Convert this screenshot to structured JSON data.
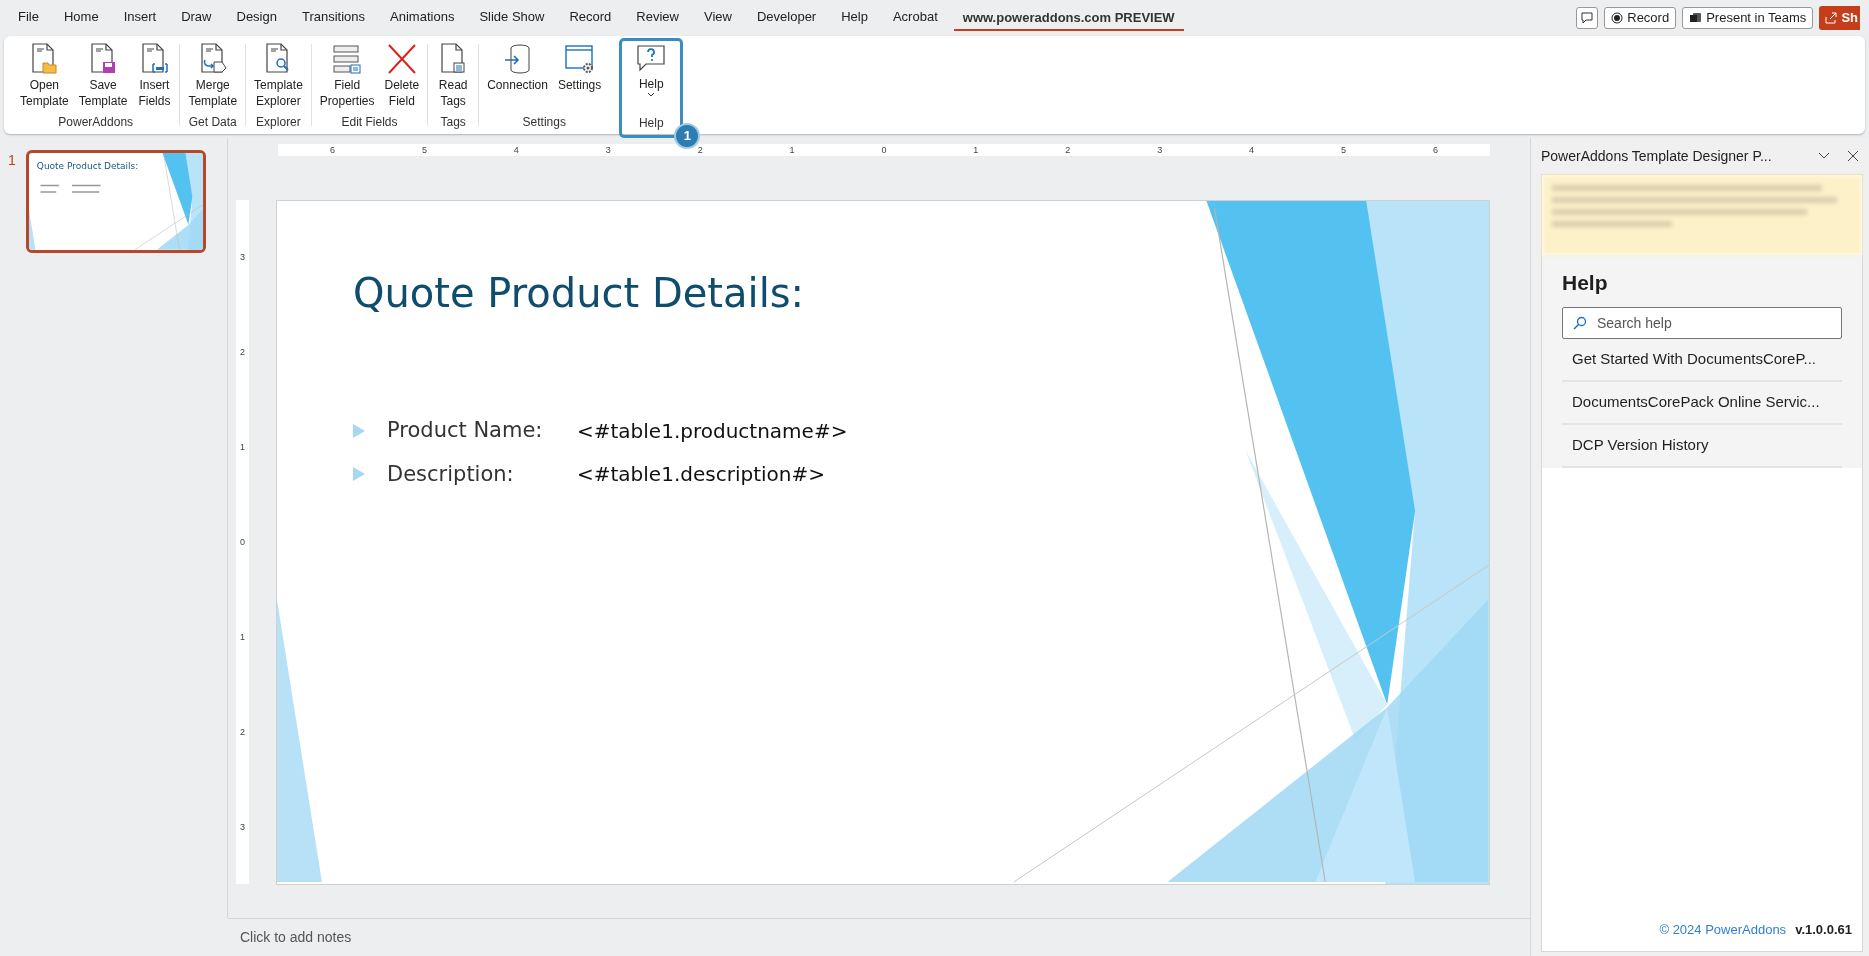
{
  "menu_tabs": [
    {
      "label": "File",
      "selected": false
    },
    {
      "label": "Home",
      "selected": false
    },
    {
      "label": "Insert",
      "selected": false
    },
    {
      "label": "Draw",
      "selected": false
    },
    {
      "label": "Design",
      "selected": false
    },
    {
      "label": "Transitions",
      "selected": false
    },
    {
      "label": "Animations",
      "selected": false
    },
    {
      "label": "Slide Show",
      "selected": false
    },
    {
      "label": "Record",
      "selected": false
    },
    {
      "label": "Review",
      "selected": false
    },
    {
      "label": "View",
      "selected": false
    },
    {
      "label": "Developer",
      "selected": false
    },
    {
      "label": "Help",
      "selected": false
    },
    {
      "label": "Acrobat",
      "selected": false
    },
    {
      "label": "www.poweraddons.com PREVIEW",
      "selected": true
    }
  ],
  "title_actions": {
    "record": "Record",
    "teams": "Present in Teams",
    "share": "Sh"
  },
  "ribbon": {
    "groups": [
      {
        "label": "PowerAddons",
        "buttons": [
          {
            "lines": [
              "Open",
              "Template"
            ],
            "kind": "open"
          },
          {
            "lines": [
              "Save",
              "Template"
            ],
            "kind": "save"
          },
          {
            "lines": [
              "Insert",
              "Fields"
            ],
            "kind": "insert"
          }
        ]
      },
      {
        "label": "Get Data",
        "buttons": [
          {
            "lines": [
              "Merge",
              "Template"
            ],
            "kind": "merge"
          }
        ]
      },
      {
        "label": "Explorer",
        "buttons": [
          {
            "lines": [
              "Template",
              "Explorer"
            ],
            "kind": "explorer"
          }
        ]
      },
      {
        "label": "Edit Fields",
        "buttons": [
          {
            "lines": [
              "Field",
              "Properties"
            ],
            "kind": "properties"
          },
          {
            "lines": [
              "Delete",
              "Field"
            ],
            "kind": "delete"
          }
        ]
      },
      {
        "label": "Tags",
        "buttons": [
          {
            "lines": [
              "Read",
              "Tags"
            ],
            "kind": "read"
          }
        ]
      },
      {
        "label": "Settings",
        "buttons": [
          {
            "lines": [
              "Connection"
            ],
            "kind": "connection"
          },
          {
            "lines": [
              "Settings"
            ],
            "kind": "settings"
          }
        ]
      },
      {
        "label": "Help",
        "callout": "1",
        "buttons": [
          {
            "lines": [
              "Help"
            ],
            "kind": "help"
          }
        ]
      }
    ]
  },
  "h_ruler": [
    "6",
    "5",
    "4",
    "3",
    "2",
    "1",
    "0",
    "1",
    "2",
    "3",
    "4",
    "5",
    "6"
  ],
  "v_ruler": [
    "3",
    "2",
    "1",
    "0",
    "1",
    "2",
    "3"
  ],
  "slides": [
    {
      "number": "1",
      "selected": true,
      "title": "Quote Product Details:"
    }
  ],
  "slide": {
    "title": "Quote Product Details:",
    "bullets": [
      {
        "label": "Product Name:",
        "value": "<#table1.productname#>"
      },
      {
        "label": "Description:",
        "value": "<#table1.description#>"
      }
    ]
  },
  "notes_placeholder": "Click to add notes",
  "task_pane": {
    "title": "PowerAddons Template Designer P...",
    "heading": "Help",
    "search": {
      "placeholder": "Search help"
    },
    "links": [
      "Get Started With DocumentsCoreP...",
      "DocumentsCorePack Online Servic...",
      "DCP Version History"
    ],
    "copyright": "© 2024 PowerAddons",
    "version": "v.1.0.0.61"
  }
}
